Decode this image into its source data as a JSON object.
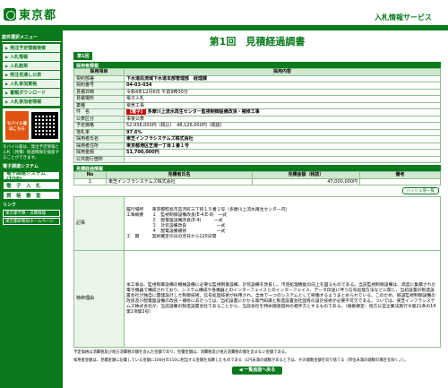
{
  "header": {
    "logo_text": "東京都",
    "service_name": "入札情報サービス"
  },
  "sidebar": {
    "section1": "案件選択メニュー",
    "items": [
      "発注予定情報検索",
      "入札情報",
      "入札結果",
      "発注見通し公表",
      "入札参加資格",
      "書類ダウンロード",
      "入札参加者情報"
    ],
    "mobile_label": "モバイル版はこちら",
    "mobile_note": "モバイル版は、発注予定情報と入札（見積）経過情報を検索することができます。",
    "section2": "電子調達システム",
    "items2": [
      "電子調達システム(TOP)",
      "電　子　入　札",
      "資　格　審　査"
    ],
    "section3": "リンク",
    "links": [
      "東京都予算・決算情報",
      "東京都財務局ホームページ"
    ]
  },
  "main": {
    "title": "第1回　見積経過調書",
    "round_tab": "第1回",
    "section_case": "採用者情報",
    "col_item": "採用項目",
    "col_content": "採用内容",
    "rows": [
      {
        "label": "契約部署",
        "value": "下水道局流域下水道本部管理部　経理課"
      },
      {
        "label": "契約番号",
        "value": "04-03-034"
      },
      {
        "label": "見積日時",
        "value": "令和4年12月6日 午前9時30分"
      },
      {
        "label": "見積場所",
        "value": "電子入札"
      },
      {
        "label": "業種",
        "value": "電気工事"
      },
      {
        "label": "件　名",
        "badge": "【電子】",
        "value": "多摩川上流水再生センター監視制御設備改良・補修工事"
      },
      {
        "label": "公表区分",
        "value": "事後公表"
      },
      {
        "label": "予定価格",
        "value": "52,938,000円（税込）　48,126,000円（税抜）"
      },
      {
        "label": "落札率",
        "value": "97.6%"
      },
      {
        "label": "採用者氏名",
        "value": "東芝インフラシステムズ株式会社"
      },
      {
        "label": "採用者住所",
        "value": "東京都港区芝浦一丁目１番１号"
      },
      {
        "label": "採用金額",
        "value": "51,700,000円"
      },
      {
        "label": "公共施行箇所",
        "value": ""
      }
    ],
    "section_bid": "見積経過情報",
    "bid_headers": [
      "No",
      "見積者氏名",
      "見積金額（税抜）",
      "備考"
    ],
    "bids": [
      {
        "no": "1",
        "name": "東芝インフラシステムズ株式会社",
        "amount": "47,000,000円",
        "note": ""
      }
    ],
    "history_button": "ハッシュ値一覧",
    "remarks_label": "記事",
    "remarks": "履行場所　　東京都昭島市宮沢町三丁目１５番１号（多摩川上流水再生センター内）\n工事概要　　１　監視制御設備改良(E-4,E-9)　一式\n　　　　　　２　配電盤設備改良(E-4)　　　一式\n　　　　　　３　計装設備改良　　　　　　　一式\n　　　　　　４　配電設備補修　　　　　　　一式\n工　期　　　契約確定の日の翌日から120日間",
    "special_label": "特命理由",
    "special": "本工事は、監視制御設備の機械設備に必要な監視制御設備、計装設備を改良し、汚泥処理機能の向上を図るものである。当該監視制御設備は、高度に集積された電子機器で構成されており、システム構成や各機器とのインターフェイスとのインターフェイス、データ伝送に伴う信号処理方法などに関し、当初設置の製造設置会社が独自に開発設計した制御技術、信号処理技術が採用され、全体で一つのシステムとして稼働するようまとめられている。このため、既設監視制御設備の改良及び配電盤設備の改良・補修にあたっては、当初設置にかかる専門知識と製造設置会社固有の設計技術が必要不可欠である。ついては、東芝インフラシステムズ株式会社が、当該設備の製造設置会社であることから、当該会社を特命随意契約の相手方とするものである。（根拠規定：地方公営企業法施行令第21条の14第1項第2号）",
    "footnote1": "予定価格は消費税及び地方消費税の額を含んだ金額であり、見積金額は、消費税及び地方消費税の額を含まない金額である。",
    "footnote2": "採用者金額は、見積金額に記載している金額に100分の110に相当する金額を加算したものである（1円未満の端数があるときは、その端数金額を切り捨てる（単位未満の端数の場合を除く。））。",
    "back_button": "◀ 一覧画面へ戻る"
  },
  "colors": {
    "brand_green": "#0a7a1c",
    "header_bg": "#cfe8cf",
    "label_bg": "#e9f5e9",
    "badge_red": "#cc0000",
    "mobile_orange": "#e0540f"
  }
}
